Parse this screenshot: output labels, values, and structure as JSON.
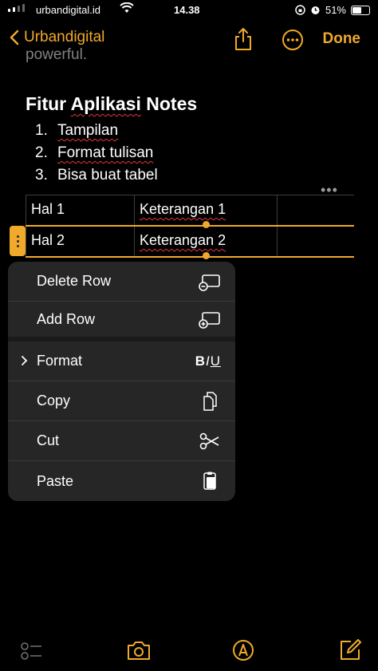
{
  "status_bar": {
    "carrier": "urbandigital.id",
    "time": "14.38",
    "battery": "51%"
  },
  "nav": {
    "back_label": "Urbandigital",
    "done_label": "Done"
  },
  "note": {
    "prev_text": "powerful.",
    "heading_pre": "Fitur ",
    "heading_wavy": "Aplikasi",
    "heading_post": " Notes",
    "list": [
      {
        "num": "1.",
        "text": "Tampilan"
      },
      {
        "num": "2.",
        "text": "Format tulisan"
      },
      {
        "num": "3.",
        "text": "Bisa buat tabel"
      }
    ],
    "table_more": "•••",
    "table": [
      {
        "c1": "Hal 1",
        "c2": "Keterangan 1",
        "c3": ""
      },
      {
        "c1": "Hal 2",
        "c2": "Keterangan 2",
        "c3": ""
      }
    ]
  },
  "menu": {
    "items": [
      {
        "label": "Delete Row",
        "icon": "delete-row-icon"
      },
      {
        "label": "Add Row",
        "icon": "add-row-icon"
      },
      {
        "label": "Format",
        "icon": "text-format-icon",
        "shortcut_b": "B",
        "shortcut_i": "I",
        "shortcut_u": "U"
      },
      {
        "label": "Copy",
        "icon": "copy-icon"
      },
      {
        "label": "Cut",
        "icon": "scissors-icon"
      },
      {
        "label": "Paste",
        "icon": "paste-icon"
      }
    ]
  },
  "colors": {
    "accent": "#f0a92a",
    "background": "#000000",
    "menu_bg": "#262626",
    "spell_underline": "#e0393e"
  },
  "toolbar": {
    "icons": [
      "checklist-icon",
      "camera-icon",
      "markup-icon",
      "compose-icon"
    ]
  }
}
